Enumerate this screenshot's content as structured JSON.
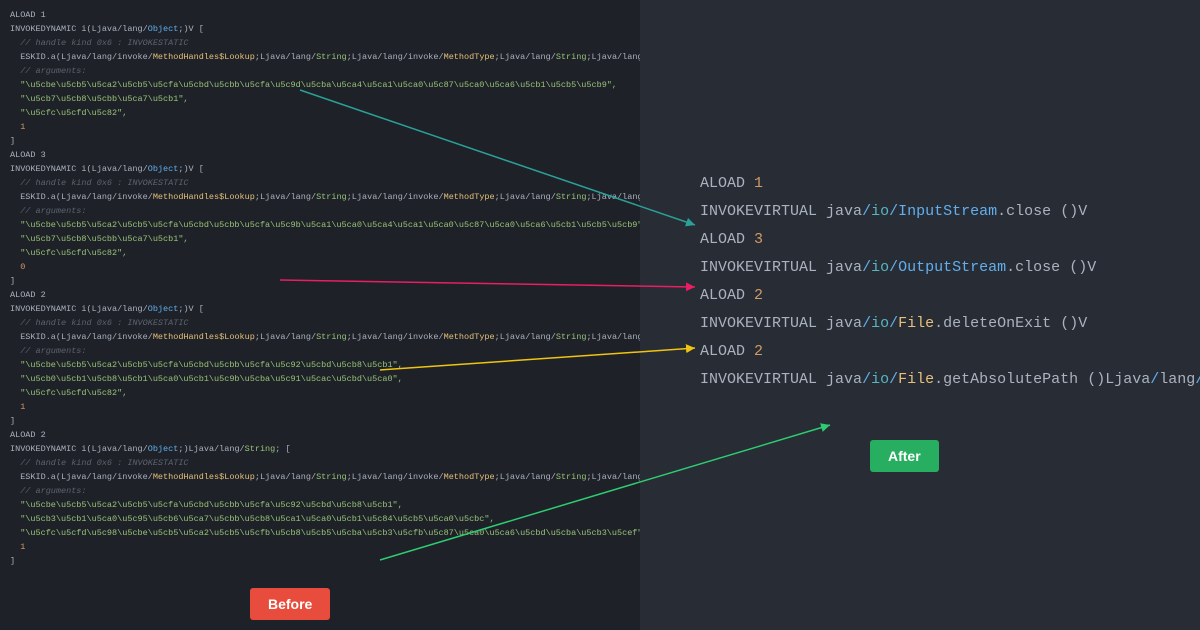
{
  "badges": {
    "before": "Before",
    "after": "After"
  },
  "left": {
    "blocks": [
      {
        "aload": "ALOAD 1",
        "invokedynamic": "INVOKEDYNAMIC i(Ljava/lang/Object;)V [",
        "comment1": "  // handle kind 0x6 : INVOKESTATIC",
        "bsm": "  ESKID.a(Ljava/lang/invoke/MethodHandles$Lookup;Ljava/lang/String;Ljava/lang/invoke/MethodType;Ljava/lang/String;Ljava/lang/String;Ljava/lang/String;Ljava/lang/Integer;)L",
        "comment2": "  // arguments:",
        "arg1": "  \"\\u5cbe\\u5cb5\\u5ca2\\u5cb5\\u5cfa\\u5cbd\\u5cbb\\u5cfa\\u5c9d\\u5cba\\u5ca4\\u5ca1\\u5ca0\\u5c87\\u5ca0\\u5ca6\\u5cb1\\u5cb5\\u5cb9\",",
        "arg2": "  \"\\u5cb7\\u5cb8\\u5cbb\\u5ca7\\u5cb1\",",
        "arg3": "  \"\\u5cfc\\u5cfd\\u5c82\",",
        "arg4": "  1",
        "close": "]"
      },
      {
        "aload": "ALOAD 3",
        "invokedynamic": "INVOKEDYNAMIC i(Ljava/lang/Object;)V [",
        "comment1": "  // handle kind 0x6 : INVOKESTATIC",
        "bsm": "  ESKID.a(Ljava/lang/invoke/MethodHandles$Lookup;Ljava/lang/String;Ljava/lang/invoke/MethodType;Ljava/lang/String;Ljava/lang/String;Ljava/lang/String;Ljava/lang/Integer;)L",
        "comment2": "  // arguments:",
        "arg1": "  \"\\u5cbe\\u5cb5\\u5ca2\\u5cb5\\u5cfa\\u5cbd\\u5cbb\\u5cfa\\u5c9b\\u5ca1\\u5ca0\\u5ca4\\u5ca1\\u5ca0\\u5c87\\u5ca0\\u5ca6\\u5cb1\\u5cb5\\u5cb9\",",
        "arg2": "  \"\\u5cb7\\u5cb8\\u5cbb\\u5ca7\\u5cb1\",",
        "arg3": "  \"\\u5cfc\\u5cfd\\u5c82\",",
        "arg4": "  0",
        "close": "]"
      },
      {
        "aload": "ALOAD 2",
        "invokedynamic": "INVOKEDYNAMIC i(Ljava/lang/Object;)V [",
        "comment1": "  // handle kind 0x6 : INVOKESTATIC",
        "bsm": "  ESKID.a(Ljava/lang/invoke/MethodHandles$Lookup;Ljava/lang/String;Ljava/lang/invoke/MethodType;Ljava/lang/String;Ljava/lang/String;Ljava/lang/String;Ljava/lang/Integer;)L",
        "comment2": "  // arguments:",
        "arg1": "  \"\\u5cbe\\u5cb5\\u5ca2\\u5cb5\\u5cfa\\u5cbd\\u5cbb\\u5cfa\\u5c92\\u5cbd\\u5cb8\\u5cb1\",",
        "arg2": "  \"\\u5cb0\\u5cb1\\u5cb8\\u5cb1\\u5ca0\\u5cb1\\u5c9b\\u5cba\\u5c91\\u5cac\\u5cbd\\u5ca0\",",
        "arg3": "  \"\\u5cfc\\u5cfd\\u5c82\",",
        "arg4": "  1",
        "close": "]"
      },
      {
        "aload": "ALOAD 2",
        "invokedynamic": "INVOKEDYNAMIC i(Ljava/lang/Object;)Ljava/lang/String; [",
        "comment1": "  // handle kind 0x6 : INVOKESTATIC",
        "bsm": "  ESKID.a(Ljava/lang/invoke/MethodHandles$Lookup;Ljava/lang/String;Ljava/lang/invoke/MethodType;Ljava/lang/String;Ljava/lang/String;Ljava/lang/String;Ljava/lang/Integer;)L",
        "comment2": "  // arguments:",
        "arg1": "  \"\\u5cbe\\u5cb5\\u5ca2\\u5cb5\\u5cfa\\u5cbd\\u5cbb\\u5cfa\\u5c92\\u5cbd\\u5cb8\\u5cb1\",",
        "arg2": "  \"\\u5cb3\\u5cb1\\u5ca0\\u5c95\\u5cb6\\u5ca7\\u5cbb\\u5cb8\\u5ca1\\u5ca0\\u5cb1\\u5c84\\u5cb5\\u5ca0\\u5cbc\",",
        "arg3": "  \"\\u5cfc\\u5cfd\\u5c98\\u5cbe\\u5cb5\\u5ca2\\u5cb5\\u5cfb\\u5cb8\\u5cb5\\u5cba\\u5cb3\\u5cfb\\u5c87\\u5ca0\\u5ca6\\u5cbd\\u5cba\\u5cb3\\u5cef\",",
        "arg4": "  1",
        "close": "]"
      }
    ]
  },
  "right": {
    "lines": [
      {
        "aload": "ALOAD 1"
      },
      {
        "invoke": "INVOKEVIRTUAL",
        "pkg": "java",
        "sub": "io",
        "cls": "InputStream",
        "method": "close",
        "sig": "()V"
      },
      {
        "aload": "ALOAD 3"
      },
      {
        "invoke": "INVOKEVIRTUAL",
        "pkg": "java",
        "sub": "io",
        "cls": "OutputStream",
        "method": "close",
        "sig": "()V"
      },
      {
        "aload": "ALOAD 2"
      },
      {
        "invoke": "INVOKEVIRTUAL",
        "pkg": "java",
        "sub": "io",
        "cls": "File",
        "method": "deleteOnExit",
        "sig": "()V"
      },
      {
        "aload": "ALOAD 2"
      },
      {
        "invoke": "INVOKEVIRTUAL",
        "pkg": "java",
        "sub": "io",
        "cls": "File",
        "method": "getAbsolutePath",
        "sig2": "()Ljava/lang/String;"
      }
    ]
  },
  "colors": {
    "arrow1": "#2aa198",
    "arrow2": "#e91e63",
    "arrow3": "#f1c40f",
    "arrow4": "#2ecc71"
  }
}
